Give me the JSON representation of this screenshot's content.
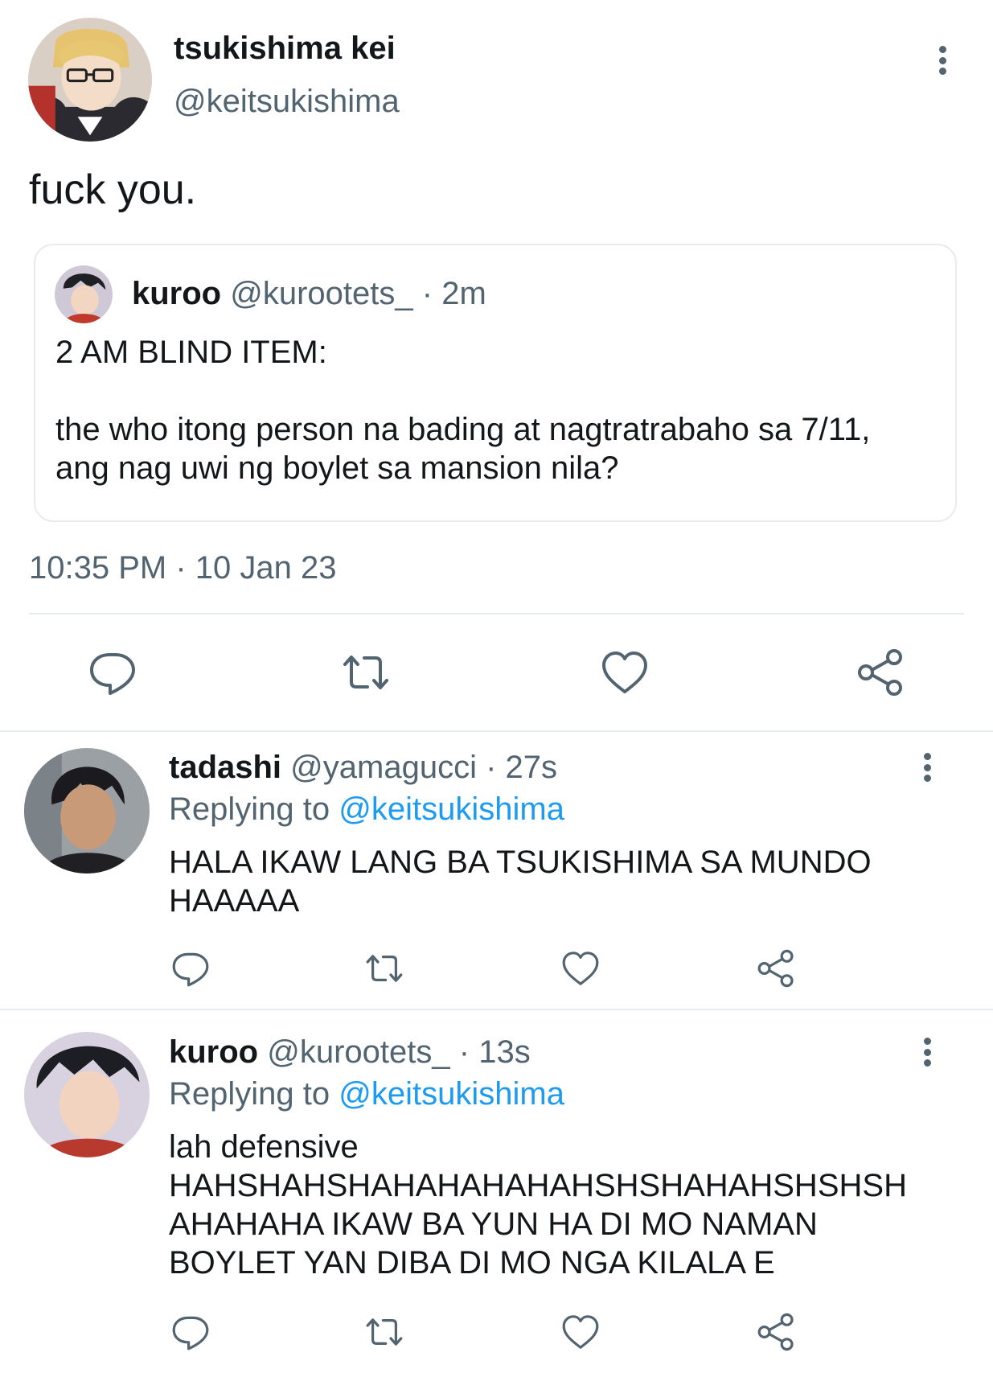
{
  "colors": {
    "text": "#14171a",
    "secondary": "#536471",
    "link": "#1d9bf0",
    "border": "#e6ecf0"
  },
  "main_tweet": {
    "display_name": "tsukishima kei",
    "handle": "@keitsukishima",
    "text": "fuck you.",
    "timestamp": "10:35 PM · 10 Jan 23",
    "quoted": {
      "display_name": "kuroo",
      "handle": "@kurootets_",
      "time": "· 2m",
      "line1": "2 AM BLIND ITEM:",
      "line2": "the who itong person na bading at nagtratrabaho sa 7/11,",
      "line3": "ang nag uwi ng boylet sa mansion nila?"
    },
    "actions": [
      "reply-icon",
      "retweet-icon",
      "like-icon",
      "share-icon"
    ]
  },
  "replies": [
    {
      "display_name": "tadashi",
      "handle": "@yamagucci",
      "time": "· 27s",
      "replying_prefix": "Replying to",
      "replying_to": "@keitsukishima",
      "lines": [
        "HALA IKAW LANG BA TSUKISHIMA SA MUNDO",
        "HAAAAA"
      ]
    },
    {
      "display_name": "kuroo",
      "handle": "@kurootets_",
      "time": "· 13s",
      "replying_prefix": "Replying to",
      "replying_to": "@keitsukishima",
      "lines": [
        "lah defensive",
        "HAHSHAHSHAHAHAHAHAHSHSHAHAHSHSHSH",
        "AHAHAHA IKAW BA YUN HA DI MO NAMAN",
        "BOYLET YAN DIBA DI MO NGA KILALA E"
      ]
    }
  ]
}
